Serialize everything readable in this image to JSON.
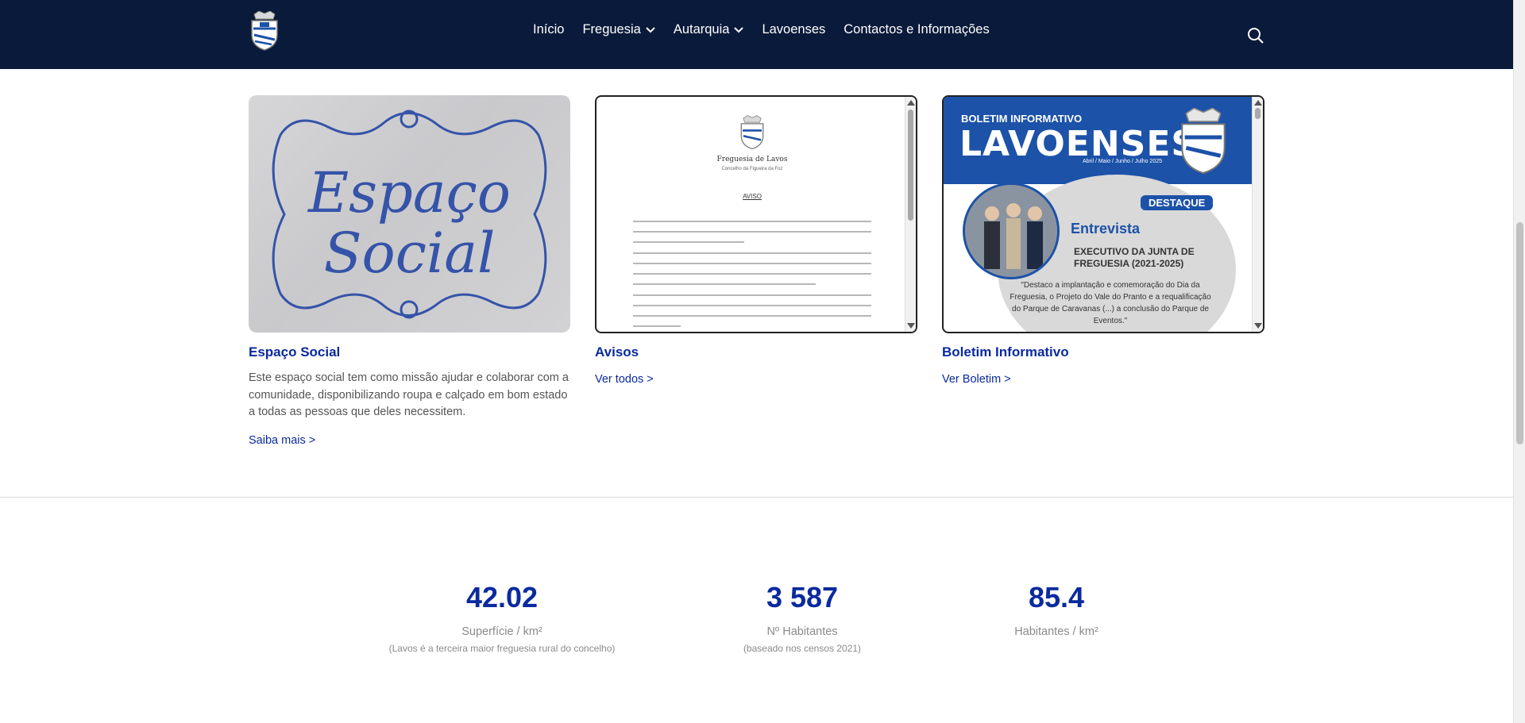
{
  "header": {
    "nav": [
      {
        "label": "Início",
        "has_dropdown": false
      },
      {
        "label": "Freguesia",
        "has_dropdown": true
      },
      {
        "label": "Autarquia",
        "has_dropdown": true
      },
      {
        "label": "Lavoenses",
        "has_dropdown": false
      },
      {
        "label": "Contactos e Informações",
        "has_dropdown": false
      }
    ]
  },
  "cards": [
    {
      "title": "Espaço Social",
      "image_text_line1": "Espaço",
      "image_text_line2": "Social",
      "description": "Este espaço social tem como missão ajudar e colaborar com a comunidade, disponibilizando roupa e calçado em bom estado a todas as pessoas que deles necessitem.",
      "link": "Saiba mais >"
    },
    {
      "title": "Avisos",
      "doc_title": "Freguesia de Lavos",
      "doc_subtitle": "Concelho da Figueira da Foz",
      "doc_heading": "AVISO",
      "link": "Ver todos >"
    },
    {
      "title": "Boletim Informativo",
      "cover_label": "BOLETIM INFORMATIVO",
      "cover_name": "LAVOENSES",
      "cover_date": "Abril / Maio / Junho / Julho 2025",
      "cover_badge": "DESTAQUE",
      "cover_heading": "Entrevista",
      "cover_subheading": "EXECUTIVO DA JUNTA DE FREGUESIA (2021-2025)",
      "cover_quote": "\"Destaco a implantação e comemoração do Dia da Freguesia, o Projeto do Vale do Pranto e a requalificação do Parque de Caravanas (...) a conclusão do Parque de Eventos.\"",
      "link": "Ver Boletim >"
    }
  ],
  "stats": [
    {
      "value": "42.02",
      "label": "Superfície / km²",
      "note": "(Lavos é a terceira maior freguesia rural do concelho)"
    },
    {
      "value": "3 587",
      "label": "Nº Habitantes",
      "note": "(baseado nos censos 2021)"
    },
    {
      "value": "85.4",
      "label": "Habitantes / km²",
      "note": ""
    }
  ],
  "colors": {
    "header_bg": "#0a1a3a",
    "accent": "#0a2a9e",
    "bulletin_blue": "#1c52a8"
  },
  "icons": {
    "search": "search-icon",
    "chevron": "chevron-down-icon",
    "logo": "coat-of-arms-logo"
  }
}
